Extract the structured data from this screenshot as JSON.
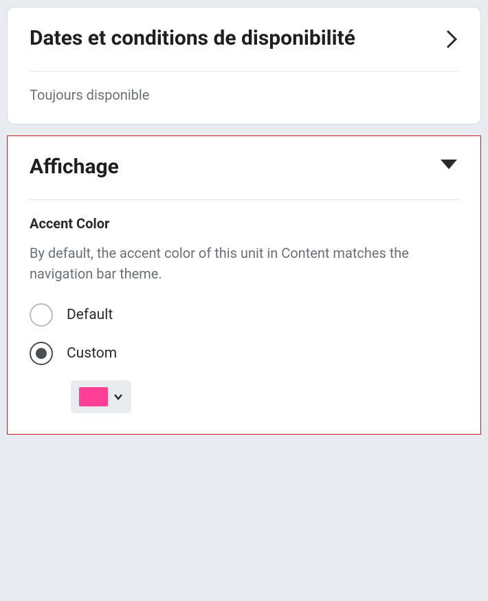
{
  "panels": {
    "availability": {
      "title": "Dates et conditions de disponibilité",
      "status": "Toujours disponible"
    },
    "display": {
      "title": "Affichage",
      "accent": {
        "label": "Accent Color",
        "description": "By default, the accent color of this unit in Content matches the navigation bar theme.",
        "options": {
          "default_label": "Default",
          "custom_label": "Custom"
        },
        "selected": "custom",
        "custom_color": "#ff3f96"
      }
    }
  }
}
